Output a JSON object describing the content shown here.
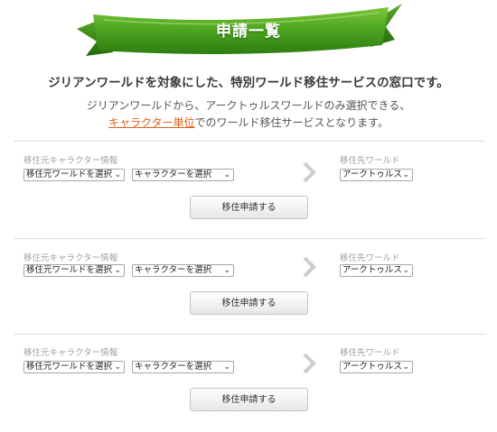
{
  "page": {
    "title": "申請一覧"
  },
  "intro": {
    "headline": "ジリアンワールドを対象にした、特別ワールド移住サービスの窓口です。",
    "line1": "ジリアンワールドから、アークトゥルスワールドのみ選択できる、",
    "link": "キャラクター単位",
    "line2_suffix": "でのワールド移住サービスとなります。"
  },
  "requests": [
    {
      "source_label": "移住元キャラクター情報",
      "source_world": "移住元ワールドを選択",
      "character": "キャラクターを選択",
      "dest_label": "移住先ワールド",
      "dest_world": "アークトゥルス",
      "submit": "移住申請する"
    },
    {
      "source_label": "移住元キャラクター情報",
      "source_world": "移住元ワールドを選択",
      "character": "キャラクターを選択",
      "dest_label": "移住先ワールド",
      "dest_world": "アークトゥルス",
      "submit": "移住申請する"
    },
    {
      "source_label": "移住元キャラクター情報",
      "source_world": "移住元ワールドを選択",
      "character": "キャラクターを選択",
      "dest_label": "移住先ワールド",
      "dest_world": "アークトゥルス",
      "submit": "移住申請する"
    }
  ],
  "icons": {
    "banner": "green-ribbon-banner",
    "separator": "chevron-right-icon",
    "dropdown": "chevron-down-icon"
  },
  "colors": {
    "banner_green": "#3f9a1c",
    "link_orange": "#e0601a",
    "muted_label": "#a0a0a0",
    "arrow_gray": "#cccccc"
  }
}
